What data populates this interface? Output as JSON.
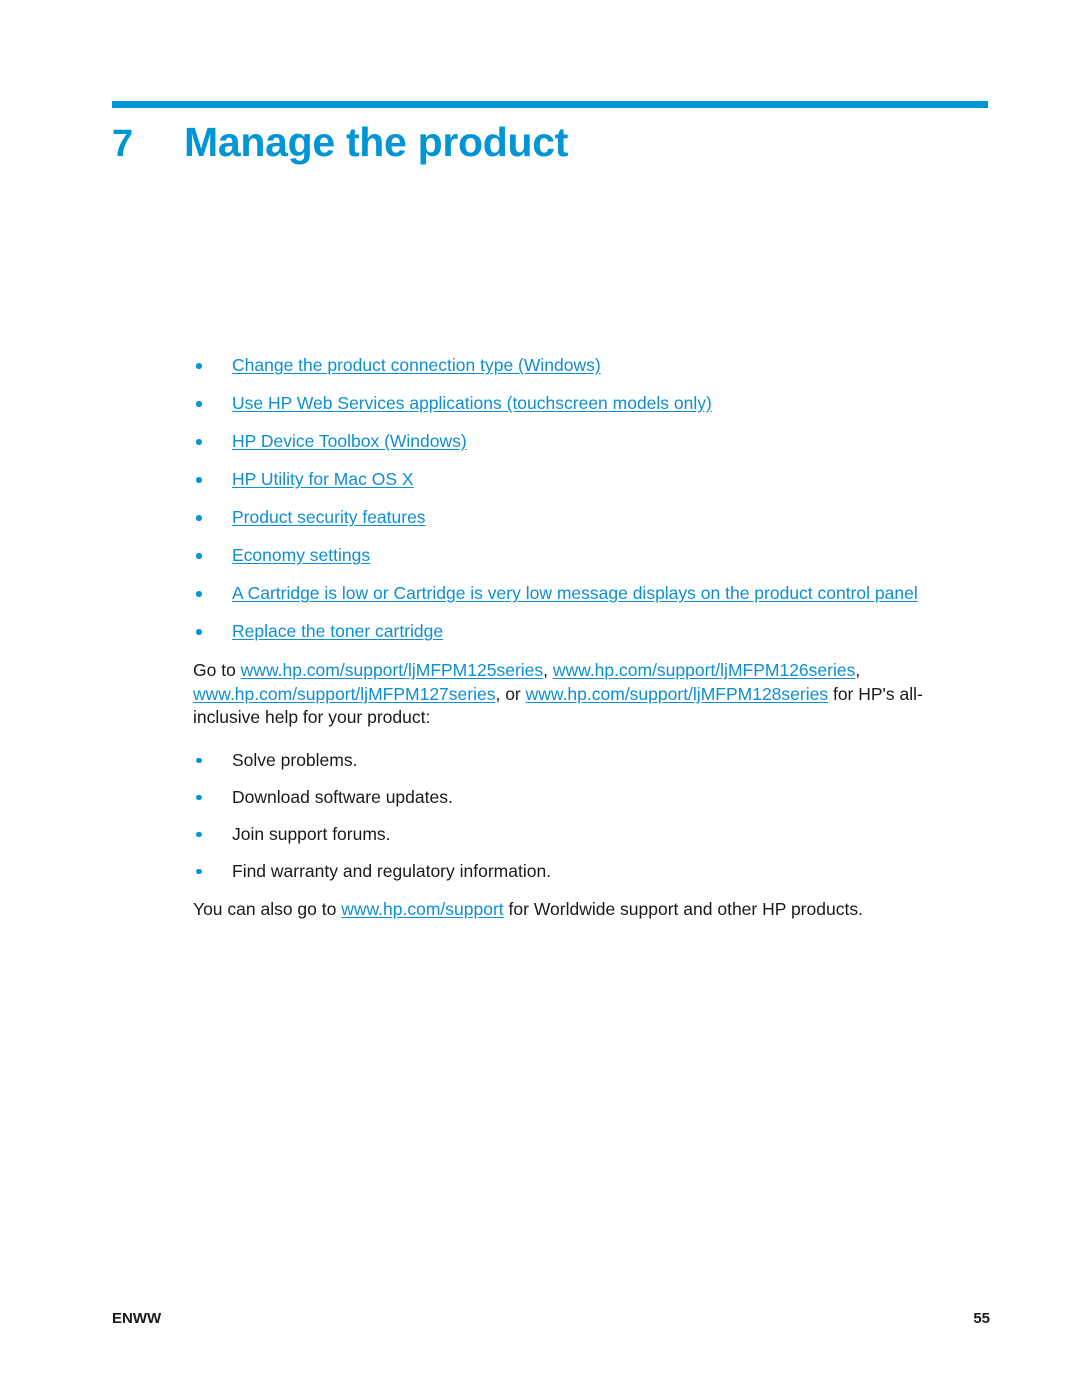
{
  "chapter": {
    "number": "7",
    "title": "Manage the product",
    "accent_color": "#0096d6"
  },
  "toc_links": [
    "Change the product connection type (Windows)",
    "Use HP Web Services applications (touchscreen models only)",
    "HP Device Toolbox (Windows)",
    "HP Utility for Mac OS X",
    "Product security features",
    "Economy settings",
    "A Cartridge is low or Cartridge is very low message displays on the product control panel",
    "Replace the toner cartridge"
  ],
  "go_to_paragraph": {
    "lead": "Go to ",
    "link1": "www.hp.com/support/ljMFPM125series",
    "sep1": ", ",
    "link2": "www.hp.com/support/ljMFPM126series",
    "sep2": ", ",
    "link3": "www.hp.com/support/ljMFPM127series",
    "sep3": ", or ",
    "link4": "www.hp.com/support/ljMFPM128series",
    "tail": " for HP's all-inclusive help for your product:"
  },
  "support_items": [
    "Solve problems.",
    "Download software updates.",
    "Join support forums.",
    "Find warranty and regulatory information."
  ],
  "also_paragraph": {
    "lead": "You can also go to ",
    "link": "www.hp.com/support",
    "tail": " for Worldwide support and other HP products."
  },
  "footer": {
    "left": "ENWW",
    "page": "55"
  }
}
